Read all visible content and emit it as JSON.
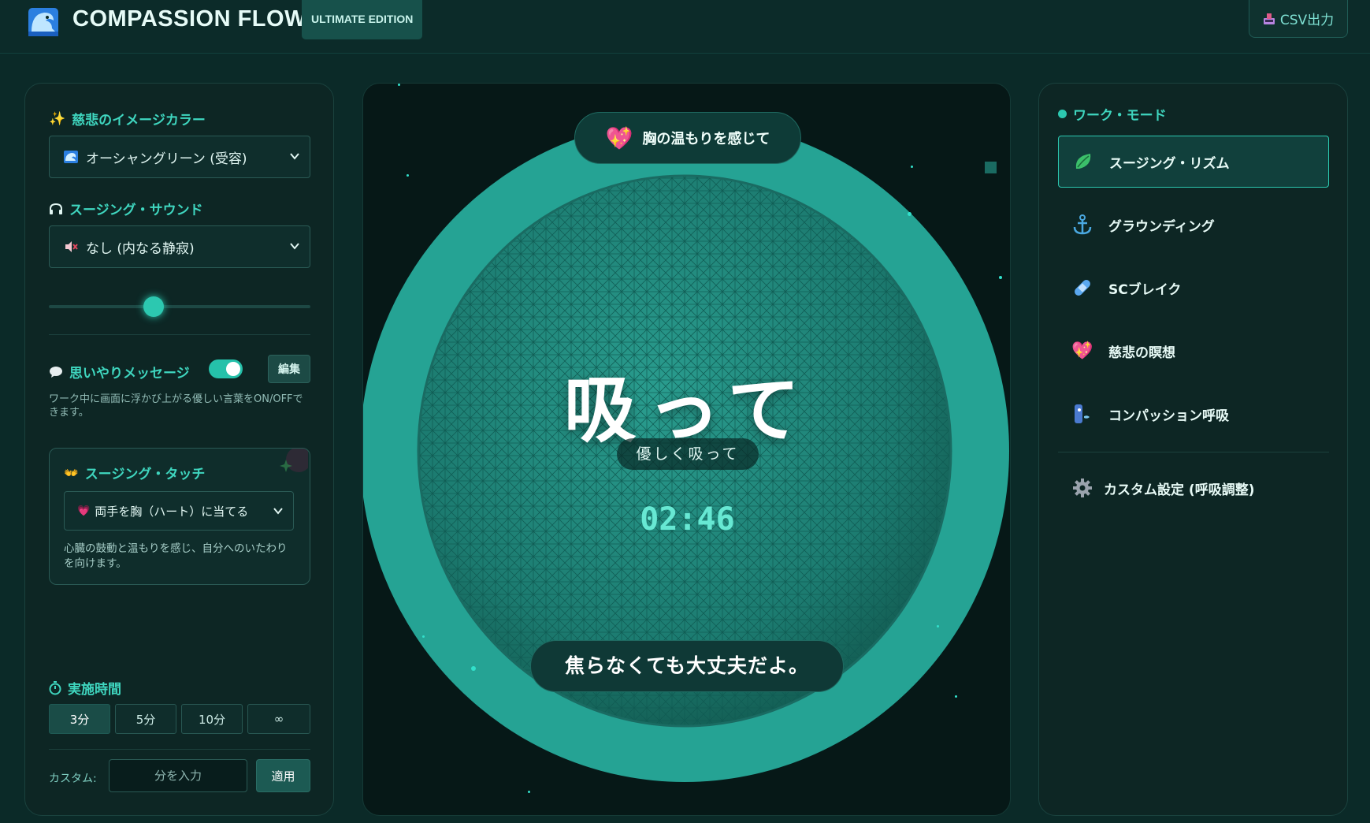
{
  "header": {
    "title": "COMPASSION FLOW",
    "edition": "ULTIMATE EDITION",
    "csv_button": "CSV出力",
    "colors": {
      "accent": "#2cc8b0",
      "bg": "#0b2a28"
    }
  },
  "left": {
    "color_label": "慈悲のイメージカラー",
    "color_value": "オーシャングリーン (受容)",
    "sound_label": "スージング・サウンド",
    "sound_value": "なし (内なる静寂)",
    "volume_percent": 40,
    "message_label": "思いやりメッセージ",
    "message_toggle_on": true,
    "edit_button": "編集",
    "message_hint": "ワーク中に画面に浮かび上がる優しい言葉をON/OFFできます。",
    "touch_label": "スージング・タッチ",
    "touch_value": "両手を胸（ハート）に当てる",
    "touch_hint": "心臓の鼓動と温もりを感じ、自分へのいたわりを向けます。",
    "duration_label": "実施時間",
    "durations": [
      "3分",
      "5分",
      "10分",
      "∞"
    ],
    "active_duration": "3分",
    "custom_label": "カスタム:",
    "custom_placeholder": "分を入力",
    "apply_button": "適用"
  },
  "center": {
    "top_pill": "胸の温もりを感じて",
    "breath_word": "吸って",
    "breath_sub": "優しく吸って",
    "timer": "02:46",
    "message": "焦らなくても大丈夫だよ。"
  },
  "right": {
    "section_label": "ワーク・モード",
    "modes": [
      {
        "label": "スージング・リズム",
        "icon": "leaf-icon",
        "active": true
      },
      {
        "label": "グラウンディング",
        "icon": "anchor-icon",
        "active": false
      },
      {
        "label": "SCブレイク",
        "icon": "bandage-icon",
        "active": false
      },
      {
        "label": "慈悲の瞑想",
        "icon": "sparkling-heart-icon",
        "active": false
      },
      {
        "label": "コンパッション呼吸",
        "icon": "breathing-person-icon",
        "active": false
      }
    ],
    "custom_settings": "カスタム設定 (呼吸調整)"
  }
}
